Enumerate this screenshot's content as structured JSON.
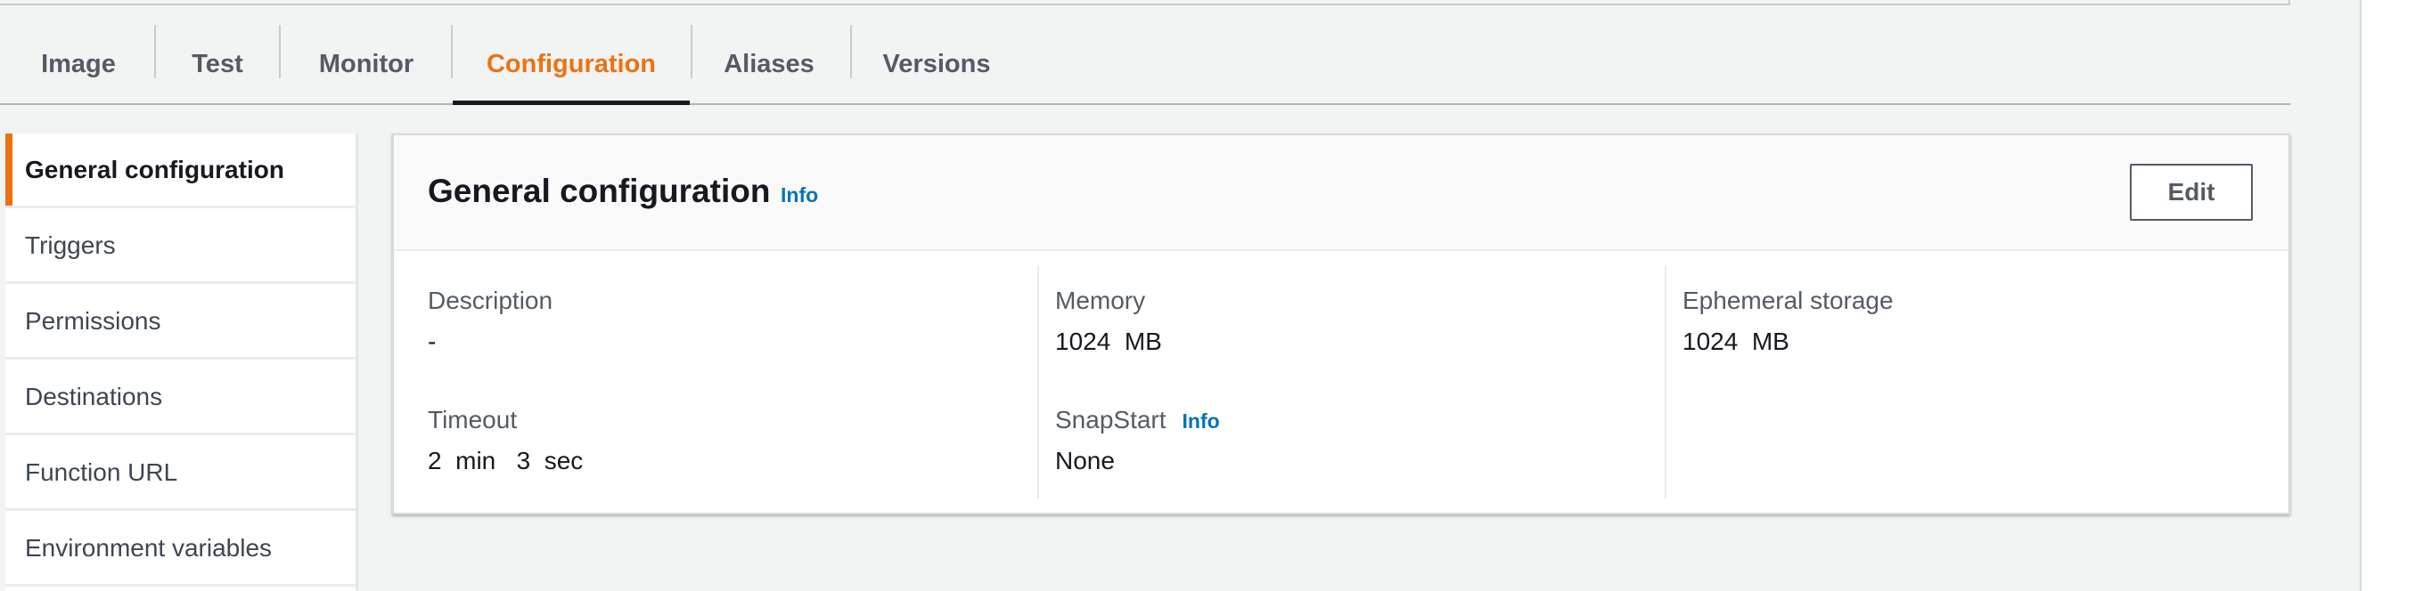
{
  "tabs": [
    {
      "label": "Image"
    },
    {
      "label": "Test"
    },
    {
      "label": "Monitor"
    },
    {
      "label": "Configuration",
      "active": true
    },
    {
      "label": "Aliases"
    },
    {
      "label": "Versions"
    }
  ],
  "sidebar": {
    "items": [
      {
        "label": "General configuration",
        "active": true
      },
      {
        "label": "Triggers"
      },
      {
        "label": "Permissions"
      },
      {
        "label": "Destinations"
      },
      {
        "label": "Function URL"
      },
      {
        "label": "Environment variables"
      }
    ]
  },
  "panel": {
    "title": "General configuration",
    "info_label": "Info",
    "edit_label": "Edit",
    "fields": {
      "description": {
        "label": "Description",
        "value": "-"
      },
      "timeout": {
        "label": "Timeout",
        "value": "2  min   3  sec"
      },
      "memory": {
        "label": "Memory",
        "value": "1024  MB"
      },
      "snapstart": {
        "label": "SnapStart",
        "info_label": "Info",
        "value": "None"
      },
      "ephemeral_storage": {
        "label": "Ephemeral storage",
        "value": "1024  MB"
      }
    }
  },
  "colors": {
    "accent": "#ec7211",
    "link": "#0073bb",
    "text": "#16191f"
  }
}
